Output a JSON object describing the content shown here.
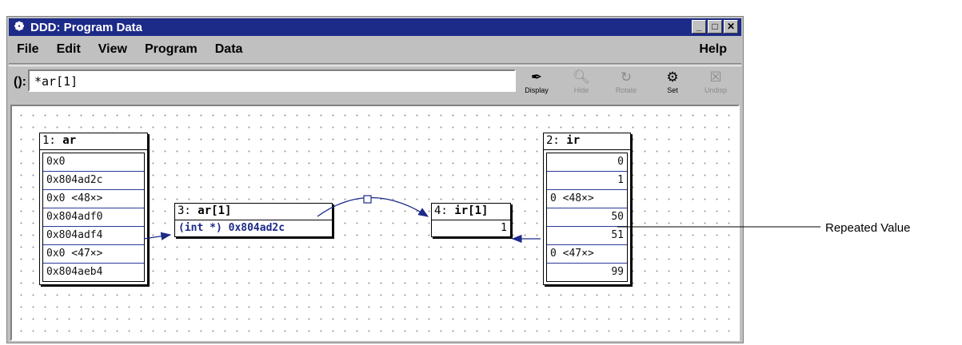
{
  "window": {
    "title": "DDD: Program Data",
    "controls": [
      "_",
      "□",
      "✕"
    ]
  },
  "menu": {
    "items": [
      "File",
      "Edit",
      "View",
      "Program",
      "Data"
    ],
    "help": "Help"
  },
  "argument": {
    "label": "():",
    "value": "*ar[1]"
  },
  "toolbar": {
    "display": "Display",
    "hide": "Hide",
    "rotate": "Rotate",
    "set": "Set",
    "undisp": "Undisp"
  },
  "nodes": {
    "ar": {
      "number": "1:",
      "name": "ar",
      "values": [
        "0x0",
        "0x804ad2c",
        "0x0  <48×>",
        "0x804adf0",
        "0x804adf4",
        "0x0  <47×>",
        "0x804aeb4"
      ]
    },
    "ar1": {
      "number": "3:",
      "name": "ar[1]",
      "value": "(int *) 0x804ad2c"
    },
    "ir1": {
      "number": "4:",
      "name": "ir[1]",
      "value": "1"
    },
    "ir": {
      "number": "2:",
      "name": "ir",
      "values": [
        "0",
        "1",
        "0 <48×>",
        "50",
        "51",
        "0 <47×>",
        "99"
      ]
    }
  },
  "annotation": "Repeated Value"
}
